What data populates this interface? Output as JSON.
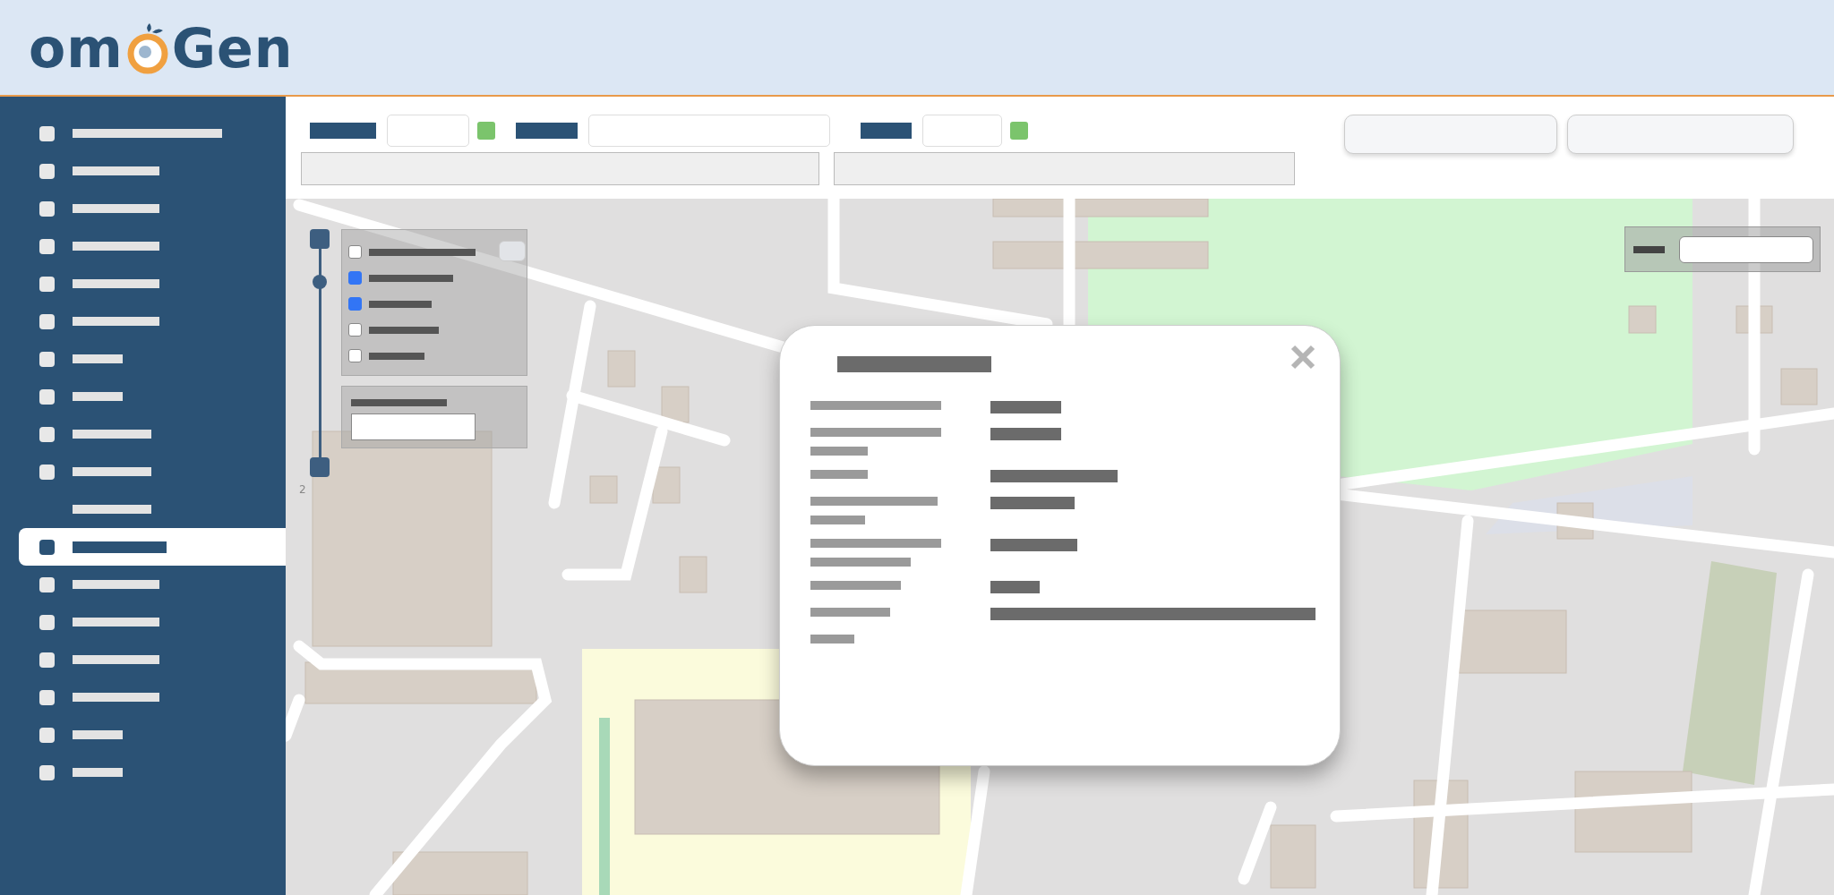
{
  "logo": {
    "text_start": "om",
    "text_end": "Gen"
  },
  "sidebar": {
    "items": [
      {
        "kind": "icon",
        "selected": false
      },
      {
        "kind": "icon",
        "selected": false
      },
      {
        "kind": "icon",
        "selected": false
      },
      {
        "kind": "icon",
        "selected": false
      },
      {
        "kind": "icon",
        "selected": false
      },
      {
        "kind": "icon",
        "selected": false
      },
      {
        "kind": "icon",
        "selected": false
      },
      {
        "kind": "icon",
        "selected": false
      },
      {
        "kind": "icon",
        "selected": false
      },
      {
        "kind": "icon",
        "selected": false
      },
      {
        "kind": "plain",
        "selected": false
      },
      {
        "kind": "icon",
        "selected": true
      },
      {
        "kind": "icon",
        "selected": false
      },
      {
        "kind": "icon",
        "selected": false
      },
      {
        "kind": "icon",
        "selected": false
      },
      {
        "kind": "icon",
        "selected": false
      },
      {
        "kind": "icon",
        "selected": false
      },
      {
        "kind": "icon",
        "selected": false
      }
    ]
  },
  "map": {
    "zoom_slider": {
      "level": 0.84
    },
    "zoom_label": "2",
    "layers": [
      {
        "checked": false
      },
      {
        "checked": true
      },
      {
        "checked": true
      },
      {
        "checked": false
      },
      {
        "checked": false
      }
    ]
  }
}
